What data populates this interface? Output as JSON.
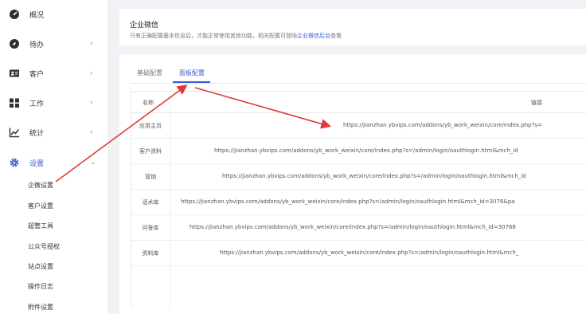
{
  "sidebar": {
    "items": [
      {
        "label": "概况",
        "icon": "dashboard-icon",
        "has_chevron": false
      },
      {
        "label": "待办",
        "icon": "compass-icon",
        "has_chevron": true
      },
      {
        "label": "客户",
        "icon": "contact-card-icon",
        "has_chevron": true
      },
      {
        "label": "工作",
        "icon": "grid-icon",
        "has_chevron": true
      },
      {
        "label": "统计",
        "icon": "line-chart-icon",
        "has_chevron": true
      },
      {
        "label": "设置",
        "icon": "gear-icon",
        "has_chevron": true,
        "expanded": true
      }
    ],
    "chevron_right": "›",
    "chevron_down": "⌄",
    "sub_items": [
      "企微设置",
      "客户设置",
      "超管工具",
      "公众号授权",
      "站点设置",
      "操作日志",
      "附件设置"
    ]
  },
  "header_card": {
    "title": "企业微信",
    "desc_prefix": "只有正确配置基本信息后，才能正常使用其他功能，相关配置可登陆",
    "desc_link": "企业微信后台",
    "desc_suffix": "查看"
  },
  "tabs": [
    {
      "label": "基础配置",
      "active": false
    },
    {
      "label": "面板配置",
      "active": true
    }
  ],
  "table": {
    "columns": [
      "名称",
      "链接"
    ],
    "rows": [
      {
        "name": "应用主页",
        "link": "https://jianzhan.ybvips.com/addons/yb_work_weixin/core/index.php?s="
      },
      {
        "name": "客户资料",
        "link": "https://jianzhan.ybvips.com/addons/yb_work_weixin/core/index.php?s=/admin/login/oauthlogin.html&mch_id"
      },
      {
        "name": "营销",
        "link": "https://jianzhan.ybvips.com/addons/yb_work_weixin/core/index.php?s=/admin/login/oauthlogin.html&mch_id"
      },
      {
        "name": "话术库",
        "link": "https://jianzhan.ybvips.com/addons/yb_work_weixin/core/index.php?s=/admin/login/oauthlogin.html&mch_id=3076&pa"
      },
      {
        "name": "问答库",
        "link": "https://jianzhan.ybvips.com/addons/yb_work_weixin/core/index.php?s=/admin/login/oauthlogin.html&mch_id=30768"
      },
      {
        "name": "资料库",
        "link": "https://jianzhan.ybvips.com/addons/yb_work_weixin/core/index.php?s=/admin/login/oauthlogin.html&mch_"
      }
    ]
  },
  "colors": {
    "accent": "#3a5bd9",
    "arrow": "#e03b3b"
  }
}
